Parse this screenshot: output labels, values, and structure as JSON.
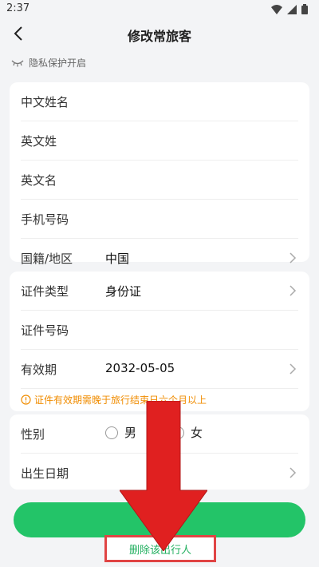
{
  "status_bar": {
    "time": "2:37"
  },
  "header": {
    "title": "修改常旅客"
  },
  "privacy": {
    "label": "隐私保护开启"
  },
  "basic_info": [
    {
      "label": "中文姓名",
      "value": ""
    },
    {
      "label": "英文姓",
      "value": ""
    },
    {
      "label": "英文名",
      "value": ""
    },
    {
      "label": "手机号码",
      "value": ""
    },
    {
      "label": "国籍/地区",
      "value": "中国"
    }
  ],
  "document": {
    "type_label": "证件类型",
    "type_value": "身份证",
    "number_label": "证件号码",
    "number_value": "",
    "expiry_label": "有效期",
    "expiry_value": "2032-05-05",
    "warning": "证件有效期需晚于旅行结束日六个月以上"
  },
  "personal": {
    "gender_label": "性别",
    "gender_options": [
      "男",
      "女"
    ],
    "birth_label": "出生日期",
    "birth_value": ""
  },
  "actions": {
    "save_label": "保存",
    "delete_label": "删除该出行人"
  },
  "colors": {
    "primary": "#23c468",
    "warning": "#f08c00",
    "highlight": "#e02020"
  }
}
